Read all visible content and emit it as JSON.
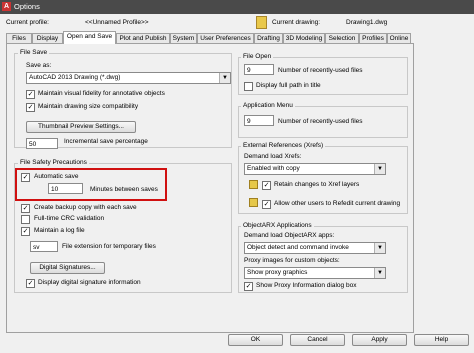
{
  "window": {
    "title": "Options"
  },
  "header": {
    "current_profile_label": "Current profile:",
    "current_profile_value": "<<Unnamed Profile>>",
    "current_drawing_label": "Current drawing:",
    "current_drawing_value": "Drawing1.dwg"
  },
  "tabs": [
    {
      "label": "Files"
    },
    {
      "label": "Display"
    },
    {
      "label": "Open and Save"
    },
    {
      "label": "Plot and Publish"
    },
    {
      "label": "System"
    },
    {
      "label": "User Preferences"
    },
    {
      "label": "Drafting"
    },
    {
      "label": "3D Modeling"
    },
    {
      "label": "Selection"
    },
    {
      "label": "Profiles"
    },
    {
      "label": "Online"
    }
  ],
  "active_tab": "Open and Save",
  "file_save": {
    "title": "File Save",
    "save_as_label": "Save as:",
    "save_as_value": "AutoCAD 2013 Drawing (*.dwg)",
    "maintain_visual_fidelity": "Maintain visual fidelity for annotative objects",
    "maintain_drawing_size": "Maintain drawing size compatibility",
    "thumbnail_button": "Thumbnail Preview Settings...",
    "incremental_value": "50",
    "incremental_label": "Incremental save percentage"
  },
  "file_safety": {
    "title": "File Safety Precautions",
    "automatic_save": "Automatic save",
    "minutes_value": "10",
    "minutes_label": "Minutes between saves",
    "create_backup": "Create backup copy with each save",
    "crc_validation": "Full-time CRC validation",
    "maintain_log": "Maintain a log file",
    "temp_ext_value": "sv",
    "temp_ext_label": "File extension for temporary files",
    "digital_signatures_button": "Digital Signatures...",
    "display_signature_info": "Display digital signature information"
  },
  "file_open": {
    "title": "File Open",
    "recent_value": "9",
    "recent_label": "Number of recently-used files",
    "display_full_path": "Display full path in title"
  },
  "app_menu": {
    "title": "Application Menu",
    "recent_value": "9",
    "recent_label": "Number of recently-used files"
  },
  "xrefs": {
    "title": "External References (Xrefs)",
    "demand_load_label": "Demand load Xrefs:",
    "demand_load_value": "Enabled with copy",
    "retain_changes": "Retain changes to Xref layers",
    "allow_other_users": "Allow other users to Refedit current drawing"
  },
  "objectarx": {
    "title": "ObjectARX Applications",
    "demand_load_label": "Demand load ObjectARX apps:",
    "demand_load_value": "Object detect and command invoke",
    "proxy_images_label": "Proxy images for custom objects:",
    "proxy_images_value": "Show proxy graphics",
    "show_proxy_dialog": "Show Proxy Information dialog box"
  },
  "footer": {
    "ok": "OK",
    "cancel": "Cancel",
    "apply": "Apply",
    "help": "Help"
  },
  "colors": {
    "highlight": "#d01010",
    "titlebar": "#4a4a4a",
    "selection": "#3399ff"
  },
  "icons": [
    "autocad-icon",
    "drawing-icon",
    "xref-icon",
    "xref-icon"
  ]
}
